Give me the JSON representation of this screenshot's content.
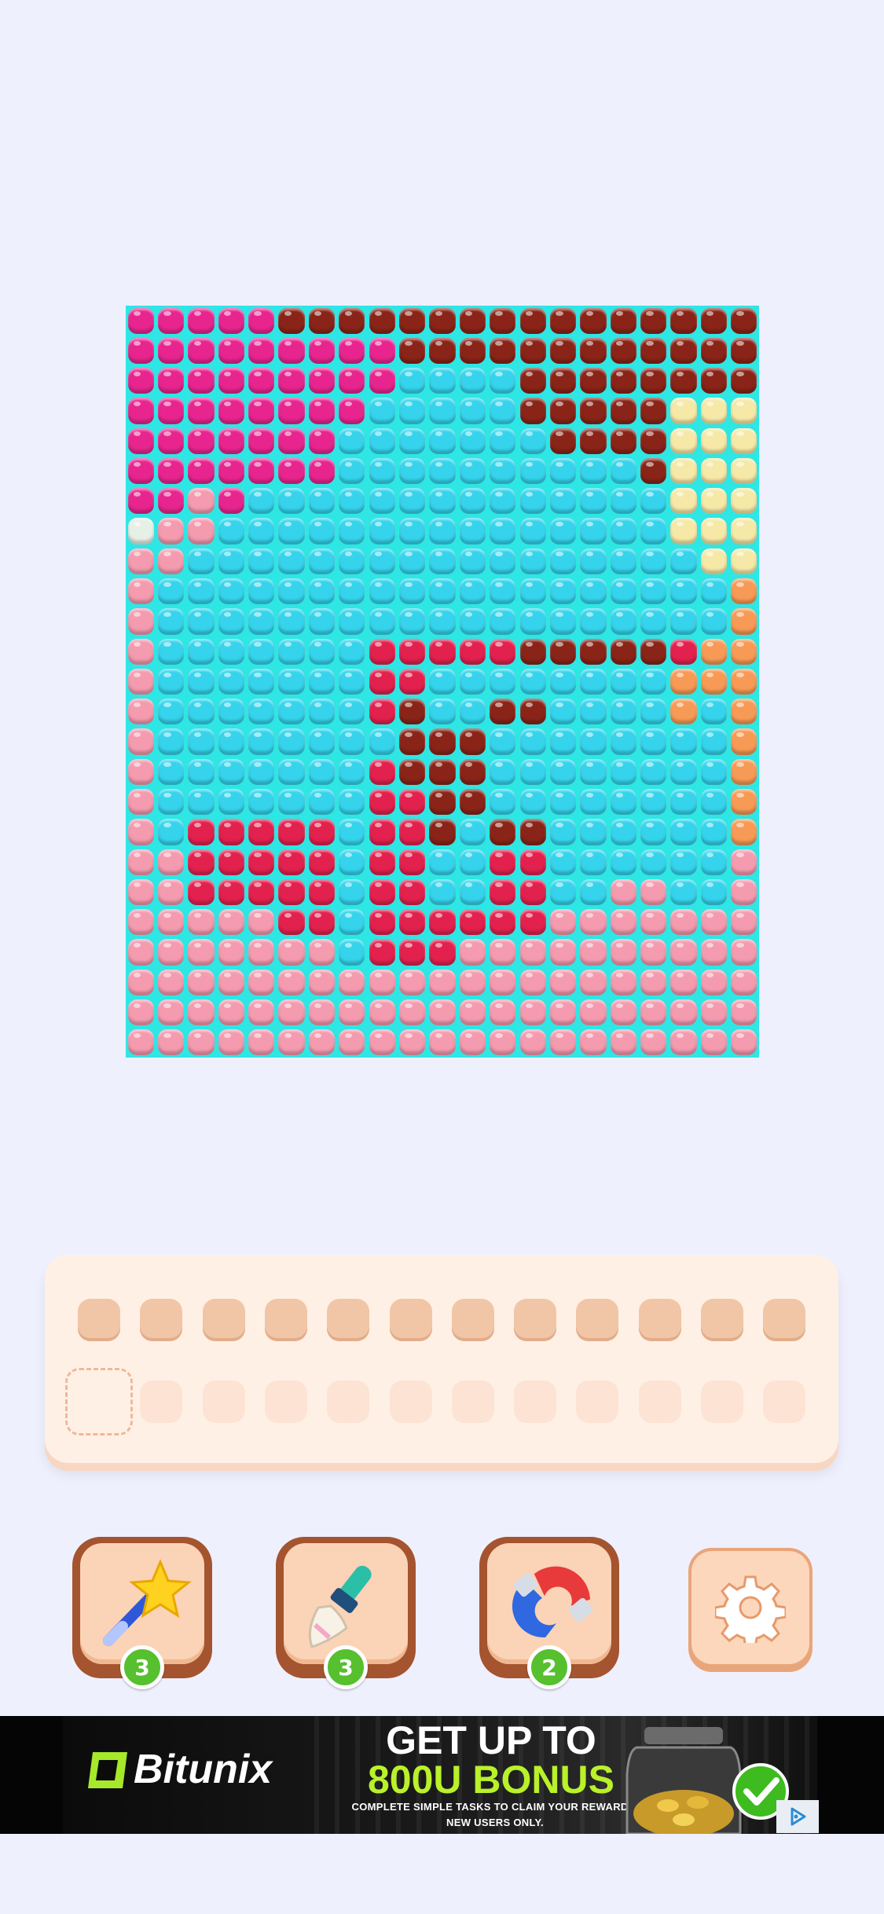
{
  "board": {
    "columns": 21,
    "rows": 25,
    "grid": [
      "MMMMMDDDDDDDDDDDDDDDD",
      "MMMMMMMMMDDDDDDDDDDDD",
      "MMMMMMMMMCCCCDDDDDDDD",
      "MMMMMMMMCCCCCDDDDDYYY",
      "MMMMMMMCCCCCCCDDDDYYY",
      "MMMMMMMCCCCCCCCCCDYYY",
      "MMPMCCCCCCCCCCCCCCYYY",
      "WPPCCCCCCCCCCCCCCCYYY",
      "PPCCCCCCCCCCCCCCCCCYY",
      "PCCCCCCCCCCCCCCCCCCCO",
      "PCCCCCCCCCCCCCCCCCCCO",
      "PCCCCCCCRRRRRDDDDDROO",
      "PCCCCCCCRRCCCCCCCCOOO",
      "PCCCCCCCRDCCDDCCCCOCO",
      "PCCCCCCCCDDDCCCCCCCCO",
      "PCCCCCCCRDDDCCCCCCCCO",
      "PCCCCCCCRRDDCCCCCCCCO",
      "PCRRRRRCRRDCDDCCCCCCO",
      "PPRRRRRCRRCCRRCCCCCCP",
      "PPRRRRRCRRCCRRCCPPCCP",
      "PPPPPRRCRRRRRRPPPPPPP",
      "PPPPPPPCRRRPPPPPPPPPP",
      "PPPPPPPPPPPPPPPPPPPPP",
      "PPPPPPPPPPPPPPPPPPPPP",
      "PPPPPPPPPPPPPPPPPPPPP"
    ],
    "palette": {
      "M": "#e8258f",
      "D": "#8a2418",
      "C": "#35d4ec",
      "Y": "#f6e8a6",
      "P": "#f49bb0",
      "R": "#e3214e",
      "O": "#f79a55",
      "W": "#e6f0e6"
    }
  },
  "tray": {
    "top_slots": 12,
    "bottom_slots": 12
  },
  "tools": [
    {
      "name": "magic-wand",
      "count": "3"
    },
    {
      "name": "brush",
      "count": "3"
    },
    {
      "name": "magnet",
      "count": "2"
    }
  ],
  "ad": {
    "brand": "Bitunix",
    "headline_line1": "GET UP TO",
    "headline_line2": "800U BONUS",
    "sub_line1": "COMPLETE SIMPLE TASKS TO CLAIM YOUR REWARDS.",
    "sub_line2": "NEW USERS ONLY."
  }
}
